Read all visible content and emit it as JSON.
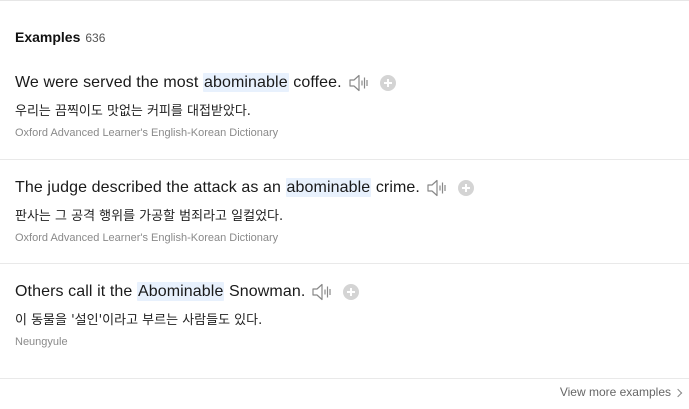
{
  "section": {
    "title": "Examples",
    "count": "636"
  },
  "examples": [
    {
      "before": "We were served the most ",
      "highlight": "abominable",
      "after": " coffee.",
      "translation": "우리는 끔찍이도 맛없는 커피를 대접받았다.",
      "source": "Oxford Advanced Learner's English-Korean Dictionary"
    },
    {
      "before": "The judge described the attack as an ",
      "highlight": "abominable",
      "after": " crime.",
      "translation": "판사는 그 공격 행위를 가공할 범죄라고 일컬었다.",
      "source": "Oxford Advanced Learner's English-Korean Dictionary"
    },
    {
      "before": "Others call it the ",
      "highlight": "Abominable",
      "after": " Snowman.",
      "translation": "이 동물을 '설인'이라고 부르는 사람들도 있다.",
      "source": "Neungyule"
    }
  ],
  "footer": {
    "view_more": "View more examples"
  },
  "icons": {
    "speaker": "speaker-icon",
    "add": "add-icon",
    "chevron": "chevron-right-icon"
  },
  "colors": {
    "highlight_bg": "#e8f1fd",
    "source_text": "#8a8a8a",
    "add_icon": "#d4d4d4"
  }
}
